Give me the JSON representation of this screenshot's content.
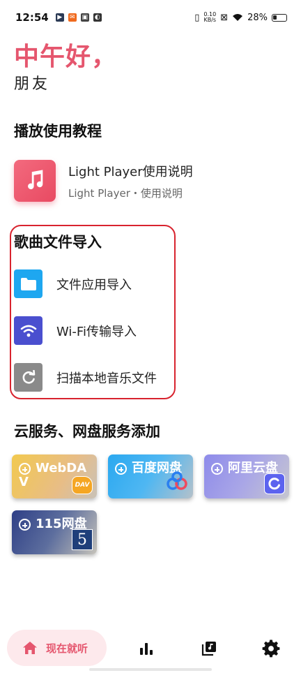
{
  "status": {
    "time": "12:54",
    "net_speed_value": "0.10",
    "net_speed_unit": "KB/s",
    "battery": "28%"
  },
  "header": {
    "greeting": "中午好，",
    "subtitle": "朋友"
  },
  "tutorial": {
    "section_title": "播放使用教程",
    "item_title": "Light Player使用说明",
    "item_subtitle": "Light Player・使用说明"
  },
  "import": {
    "section_title": "歌曲文件导入",
    "items": [
      {
        "label": "文件应用导入",
        "icon": "folder-icon",
        "color": "#1ea7f0"
      },
      {
        "label": "Wi-Fi传输导入",
        "icon": "wifi-icon",
        "color": "#4a4fcf"
      },
      {
        "label": "扫描本地音乐文件",
        "icon": "refresh-icon",
        "color": "#8a8a8a"
      }
    ]
  },
  "cloud": {
    "section_title": "云服务、网盘服务添加",
    "items": [
      {
        "label_line1": "WebDA",
        "label_line2": "V",
        "badge": "DAV"
      },
      {
        "label_line1": "百度网盘"
      },
      {
        "label_line1": "阿里云盘"
      },
      {
        "label_line1": "115网盘",
        "badge": "5"
      }
    ]
  },
  "nav": {
    "now_playing": "现在就听"
  },
  "colors": {
    "accent": "#e5566e",
    "highlight": "#d8232e"
  }
}
